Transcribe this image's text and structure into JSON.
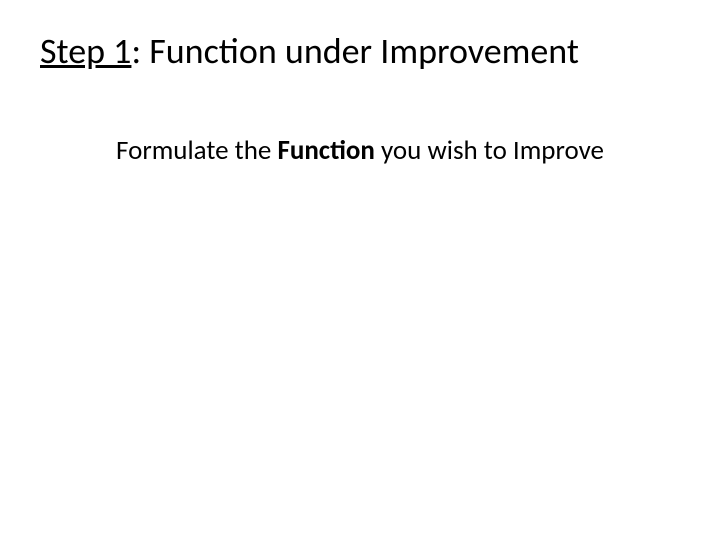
{
  "title": {
    "step_label": "Step 1",
    "separator": ": ",
    "remainder": "Function under Improvement"
  },
  "body": {
    "prefix": "Formulate the ",
    "bold_word": "Function",
    "suffix": " you wish to Improve"
  }
}
